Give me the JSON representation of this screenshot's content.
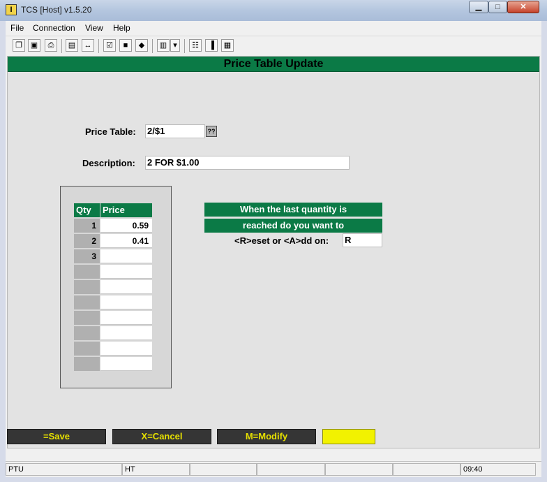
{
  "window": {
    "title": "TCS [Host]  v1.5.20",
    "icon": "I",
    "min_label": "▁",
    "max_label": "□",
    "close_label": "✕"
  },
  "menu": [
    {
      "label": "File"
    },
    {
      "label": "Connection"
    },
    {
      "label": "View"
    },
    {
      "label": "Help"
    }
  ],
  "toolbar": {
    "icons": [
      {
        "name": "copy-icon",
        "glyph": "❐"
      },
      {
        "name": "save-icon",
        "glyph": "▣"
      },
      {
        "name": "print-icon",
        "glyph": "⎙"
      },
      {
        "name": "lock-icon",
        "glyph": "▤"
      },
      {
        "name": "arrows-icon",
        "glyph": "↔"
      },
      {
        "name": "properties-icon",
        "glyph": "☑"
      },
      {
        "name": "monitor-icon",
        "glyph": "■"
      },
      {
        "name": "book-icon",
        "glyph": "◆"
      },
      {
        "name": "document-icon",
        "glyph": "▥"
      },
      {
        "name": "dropdown-icon",
        "glyph": "▾"
      },
      {
        "name": "network-icon",
        "glyph": "☷"
      },
      {
        "name": "chart-icon",
        "glyph": "▐"
      },
      {
        "name": "calculator-icon",
        "glyph": "▦"
      }
    ]
  },
  "screen": {
    "title": "Price Table Update",
    "price_table_label": "Price Table:",
    "price_table_value": "2/$1",
    "lookup_button": "??",
    "description_label": "Description:",
    "description_value": "2 FOR $1.00",
    "grid": {
      "headers": [
        "Qty",
        "Price"
      ],
      "rows": [
        {
          "qty": "1",
          "price": "0.59"
        },
        {
          "qty": "2",
          "price": "0.41"
        },
        {
          "qty": "3",
          "price": ""
        },
        {
          "qty": "",
          "price": ""
        },
        {
          "qty": "",
          "price": ""
        },
        {
          "qty": "",
          "price": ""
        },
        {
          "qty": "",
          "price": ""
        },
        {
          "qty": "",
          "price": ""
        },
        {
          "qty": "",
          "price": ""
        },
        {
          "qty": "",
          "price": ""
        }
      ]
    },
    "prompt_line1": "When the last quantity is",
    "prompt_line2": "reached do you want to",
    "reset_add_label": "<R>eset or <A>dd on:",
    "reset_add_value": "R"
  },
  "function_keys": [
    {
      "label": "=Save"
    },
    {
      "label": "X=Cancel"
    },
    {
      "label": "M=Modify"
    },
    {
      "label": ""
    }
  ],
  "status": {
    "panels": [
      "PTU",
      "HT",
      "",
      "",
      "",
      "",
      "09:40"
    ]
  },
  "colors": {
    "accent_green": "#0b7a46",
    "function_key_text": "#e6e000",
    "function_key_bg": "#353535"
  }
}
